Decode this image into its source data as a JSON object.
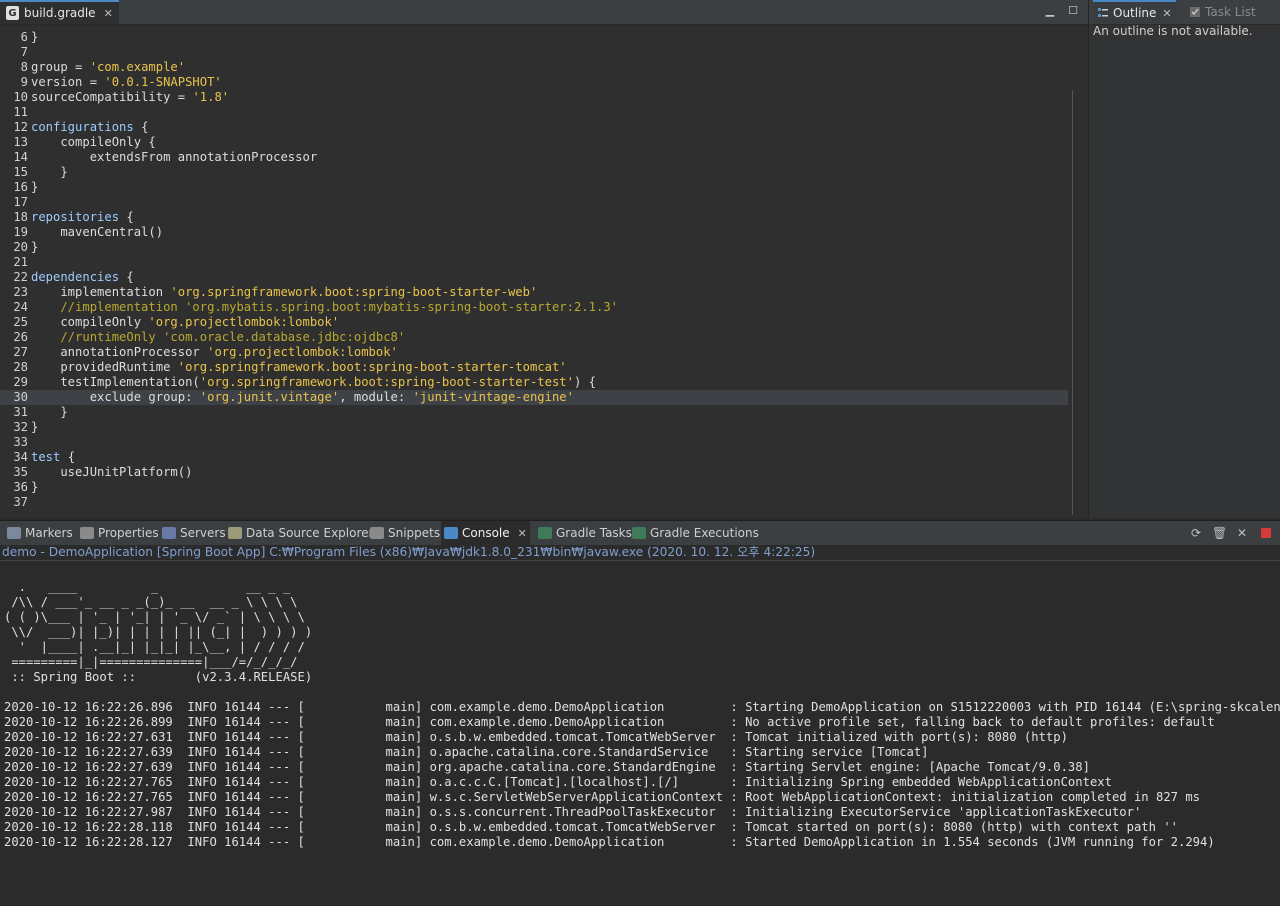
{
  "editor": {
    "tab_label": "build.gradle",
    "lines": [
      {
        "n": "6",
        "tokens": [
          {
            "t": "}",
            "c": "txt"
          }
        ]
      },
      {
        "n": "7",
        "tokens": []
      },
      {
        "n": "8",
        "tokens": [
          {
            "t": "group = ",
            "c": "txt"
          },
          {
            "t": "'com.example'",
            "c": "str"
          }
        ]
      },
      {
        "n": "9",
        "tokens": [
          {
            "t": "version = ",
            "c": "txt"
          },
          {
            "t": "'0.0.1-SNAPSHOT'",
            "c": "str"
          }
        ]
      },
      {
        "n": "10",
        "tokens": [
          {
            "t": "sourceCompatibility = ",
            "c": "txt"
          },
          {
            "t": "'1.8'",
            "c": "str"
          }
        ]
      },
      {
        "n": "11",
        "tokens": []
      },
      {
        "n": "12",
        "tokens": [
          {
            "t": "configurations",
            "c": "kw"
          },
          {
            "t": " {",
            "c": "txt"
          }
        ]
      },
      {
        "n": "13",
        "tokens": [
          {
            "t": "    compileOnly {",
            "c": "txt"
          }
        ]
      },
      {
        "n": "14",
        "tokens": [
          {
            "t": "        extendsFrom annotationProcessor",
            "c": "txt"
          }
        ]
      },
      {
        "n": "15",
        "tokens": [
          {
            "t": "    }",
            "c": "txt"
          }
        ]
      },
      {
        "n": "16",
        "tokens": [
          {
            "t": "}",
            "c": "txt"
          }
        ]
      },
      {
        "n": "17",
        "tokens": []
      },
      {
        "n": "18",
        "tokens": [
          {
            "t": "repositories",
            "c": "kw"
          },
          {
            "t": " {",
            "c": "txt"
          }
        ]
      },
      {
        "n": "19",
        "tokens": [
          {
            "t": "    mavenCentral()",
            "c": "txt"
          }
        ]
      },
      {
        "n": "20",
        "tokens": [
          {
            "t": "}",
            "c": "txt"
          }
        ]
      },
      {
        "n": "21",
        "tokens": []
      },
      {
        "n": "22",
        "tokens": [
          {
            "t": "dependencies",
            "c": "kw"
          },
          {
            "t": " {",
            "c": "txt"
          }
        ]
      },
      {
        "n": "23",
        "tokens": [
          {
            "t": "    implementation ",
            "c": "txt"
          },
          {
            "t": "'org.springframework.boot:spring-boot-starter-web'",
            "c": "str"
          }
        ]
      },
      {
        "n": "24",
        "tokens": [
          {
            "t": "    //implementation 'org.mybatis.spring.boot:mybatis-spring-boot-starter:2.1.3'",
            "c": "cmt"
          }
        ]
      },
      {
        "n": "25",
        "tokens": [
          {
            "t": "    compileOnly ",
            "c": "txt"
          },
          {
            "t": "'org.projectlombok:lombok'",
            "c": "str"
          }
        ]
      },
      {
        "n": "26",
        "tokens": [
          {
            "t": "    //runtimeOnly 'com.oracle.database.jdbc:ojdbc8'",
            "c": "cmt"
          }
        ]
      },
      {
        "n": "27",
        "tokens": [
          {
            "t": "    annotationProcessor ",
            "c": "txt"
          },
          {
            "t": "'org.projectlombok:lombok'",
            "c": "str"
          }
        ]
      },
      {
        "n": "28",
        "tokens": [
          {
            "t": "    providedRuntime ",
            "c": "txt"
          },
          {
            "t": "'org.springframework.boot:spring-boot-starter-tomcat'",
            "c": "str"
          }
        ]
      },
      {
        "n": "29",
        "tokens": [
          {
            "t": "    testImplementation(",
            "c": "txt"
          },
          {
            "t": "'org.springframework.boot:spring-boot-starter-test'",
            "c": "str"
          },
          {
            "t": ") {",
            "c": "txt"
          }
        ]
      },
      {
        "n": "30",
        "tokens": [
          {
            "t": "        exclude group: ",
            "c": "txt"
          },
          {
            "t": "'org.junit.vintage'",
            "c": "str"
          },
          {
            "t": ", module: ",
            "c": "txt"
          },
          {
            "t": "'junit-vintage-engine'",
            "c": "str"
          }
        ],
        "highlight": true
      },
      {
        "n": "31",
        "tokens": [
          {
            "t": "    }",
            "c": "txt"
          }
        ]
      },
      {
        "n": "32",
        "tokens": [
          {
            "t": "}",
            "c": "txt"
          }
        ]
      },
      {
        "n": "33",
        "tokens": []
      },
      {
        "n": "34",
        "tokens": [
          {
            "t": "test",
            "c": "kw"
          },
          {
            "t": " {",
            "c": "txt"
          }
        ]
      },
      {
        "n": "35",
        "tokens": [
          {
            "t": "    useJUnitPlatform()",
            "c": "txt"
          }
        ]
      },
      {
        "n": "36",
        "tokens": [
          {
            "t": "}",
            "c": "txt"
          }
        ]
      },
      {
        "n": "37",
        "tokens": []
      }
    ]
  },
  "outline": {
    "tab_outline": "Outline",
    "tab_tasklist": "Task List",
    "message": "An outline is not available."
  },
  "bottom": {
    "tabs": [
      {
        "label": "Markers",
        "icon": "markers-icon",
        "color": "#7a8a9a"
      },
      {
        "label": "Properties",
        "icon": "properties-icon",
        "color": "#8a8a8a"
      },
      {
        "label": "Servers",
        "icon": "servers-icon",
        "color": "#6a7aa8"
      },
      {
        "label": "Data Source Explorer",
        "icon": "data-source-icon",
        "color": "#9a9a7a"
      },
      {
        "label": "Snippets",
        "icon": "snippets-icon",
        "color": "#8a8a8a"
      },
      {
        "label": "Console",
        "icon": "console-icon",
        "color": "#4a88c7",
        "active": true
      },
      {
        "label": "Gradle Tasks",
        "icon": "gradle-tasks-icon",
        "color": "#3f7a5a"
      },
      {
        "label": "Gradle Executions",
        "icon": "gradle-executions-icon",
        "color": "#3f7a5a"
      }
    ],
    "status": "demo - DemoApplication [Spring Boot App] C:₩Program Files (x86)₩Java₩jdk1.8.0_231₩bin₩javaw.exe (2020. 10. 12. 오후 4:22:25)",
    "console_lines": [
      "",
      "  .   ____          _            __ _ _",
      " /\\\\ / ___'_ __ _ _(_)_ __  __ _ \\ \\ \\ \\",
      "( ( )\\___ | '_ | '_| | '_ \\/ _` | \\ \\ \\ \\",
      " \\\\/  ___)| |_)| | | | | || (_| |  ) ) ) )",
      "  '  |____| .__|_| |_|_| |_\\__, | / / / /",
      " =========|_|==============|___/=/_/_/_/",
      " :: Spring Boot ::        (v2.3.4.RELEASE)",
      "",
      "2020-10-12 16:22:26.896  INFO 16144 --- [           main] com.example.demo.DemoApplication         : Starting DemoApplication on S1512220003 with PID 16144 (E:\\spring-skcalendar\\demo\\bin\\main started by",
      "2020-10-12 16:22:26.899  INFO 16144 --- [           main] com.example.demo.DemoApplication         : No active profile set, falling back to default profiles: default",
      "2020-10-12 16:22:27.631  INFO 16144 --- [           main] o.s.b.w.embedded.tomcat.TomcatWebServer  : Tomcat initialized with port(s): 8080 (http)",
      "2020-10-12 16:22:27.639  INFO 16144 --- [           main] o.apache.catalina.core.StandardService   : Starting service [Tomcat]",
      "2020-10-12 16:22:27.639  INFO 16144 --- [           main] org.apache.catalina.core.StandardEngine  : Starting Servlet engine: [Apache Tomcat/9.0.38]",
      "2020-10-12 16:22:27.765  INFO 16144 --- [           main] o.a.c.c.C.[Tomcat].[localhost].[/]       : Initializing Spring embedded WebApplicationContext",
      "2020-10-12 16:22:27.765  INFO 16144 --- [           main] w.s.c.ServletWebServerApplicationContext : Root WebApplicationContext: initialization completed in 827 ms",
      "2020-10-12 16:22:27.987  INFO 16144 --- [           main] o.s.s.concurrent.ThreadPoolTaskExecutor  : Initializing ExecutorService 'applicationTaskExecutor'",
      "2020-10-12 16:22:28.118  INFO 16144 --- [           main] o.s.b.w.embedded.tomcat.TomcatWebServer  : Tomcat started on port(s): 8080 (http) with context path ''",
      "2020-10-12 16:22:28.127  INFO 16144 --- [           main] com.example.demo.DemoApplication         : Started DemoApplication in 1.554 seconds (JVM running for 2.294)"
    ]
  }
}
